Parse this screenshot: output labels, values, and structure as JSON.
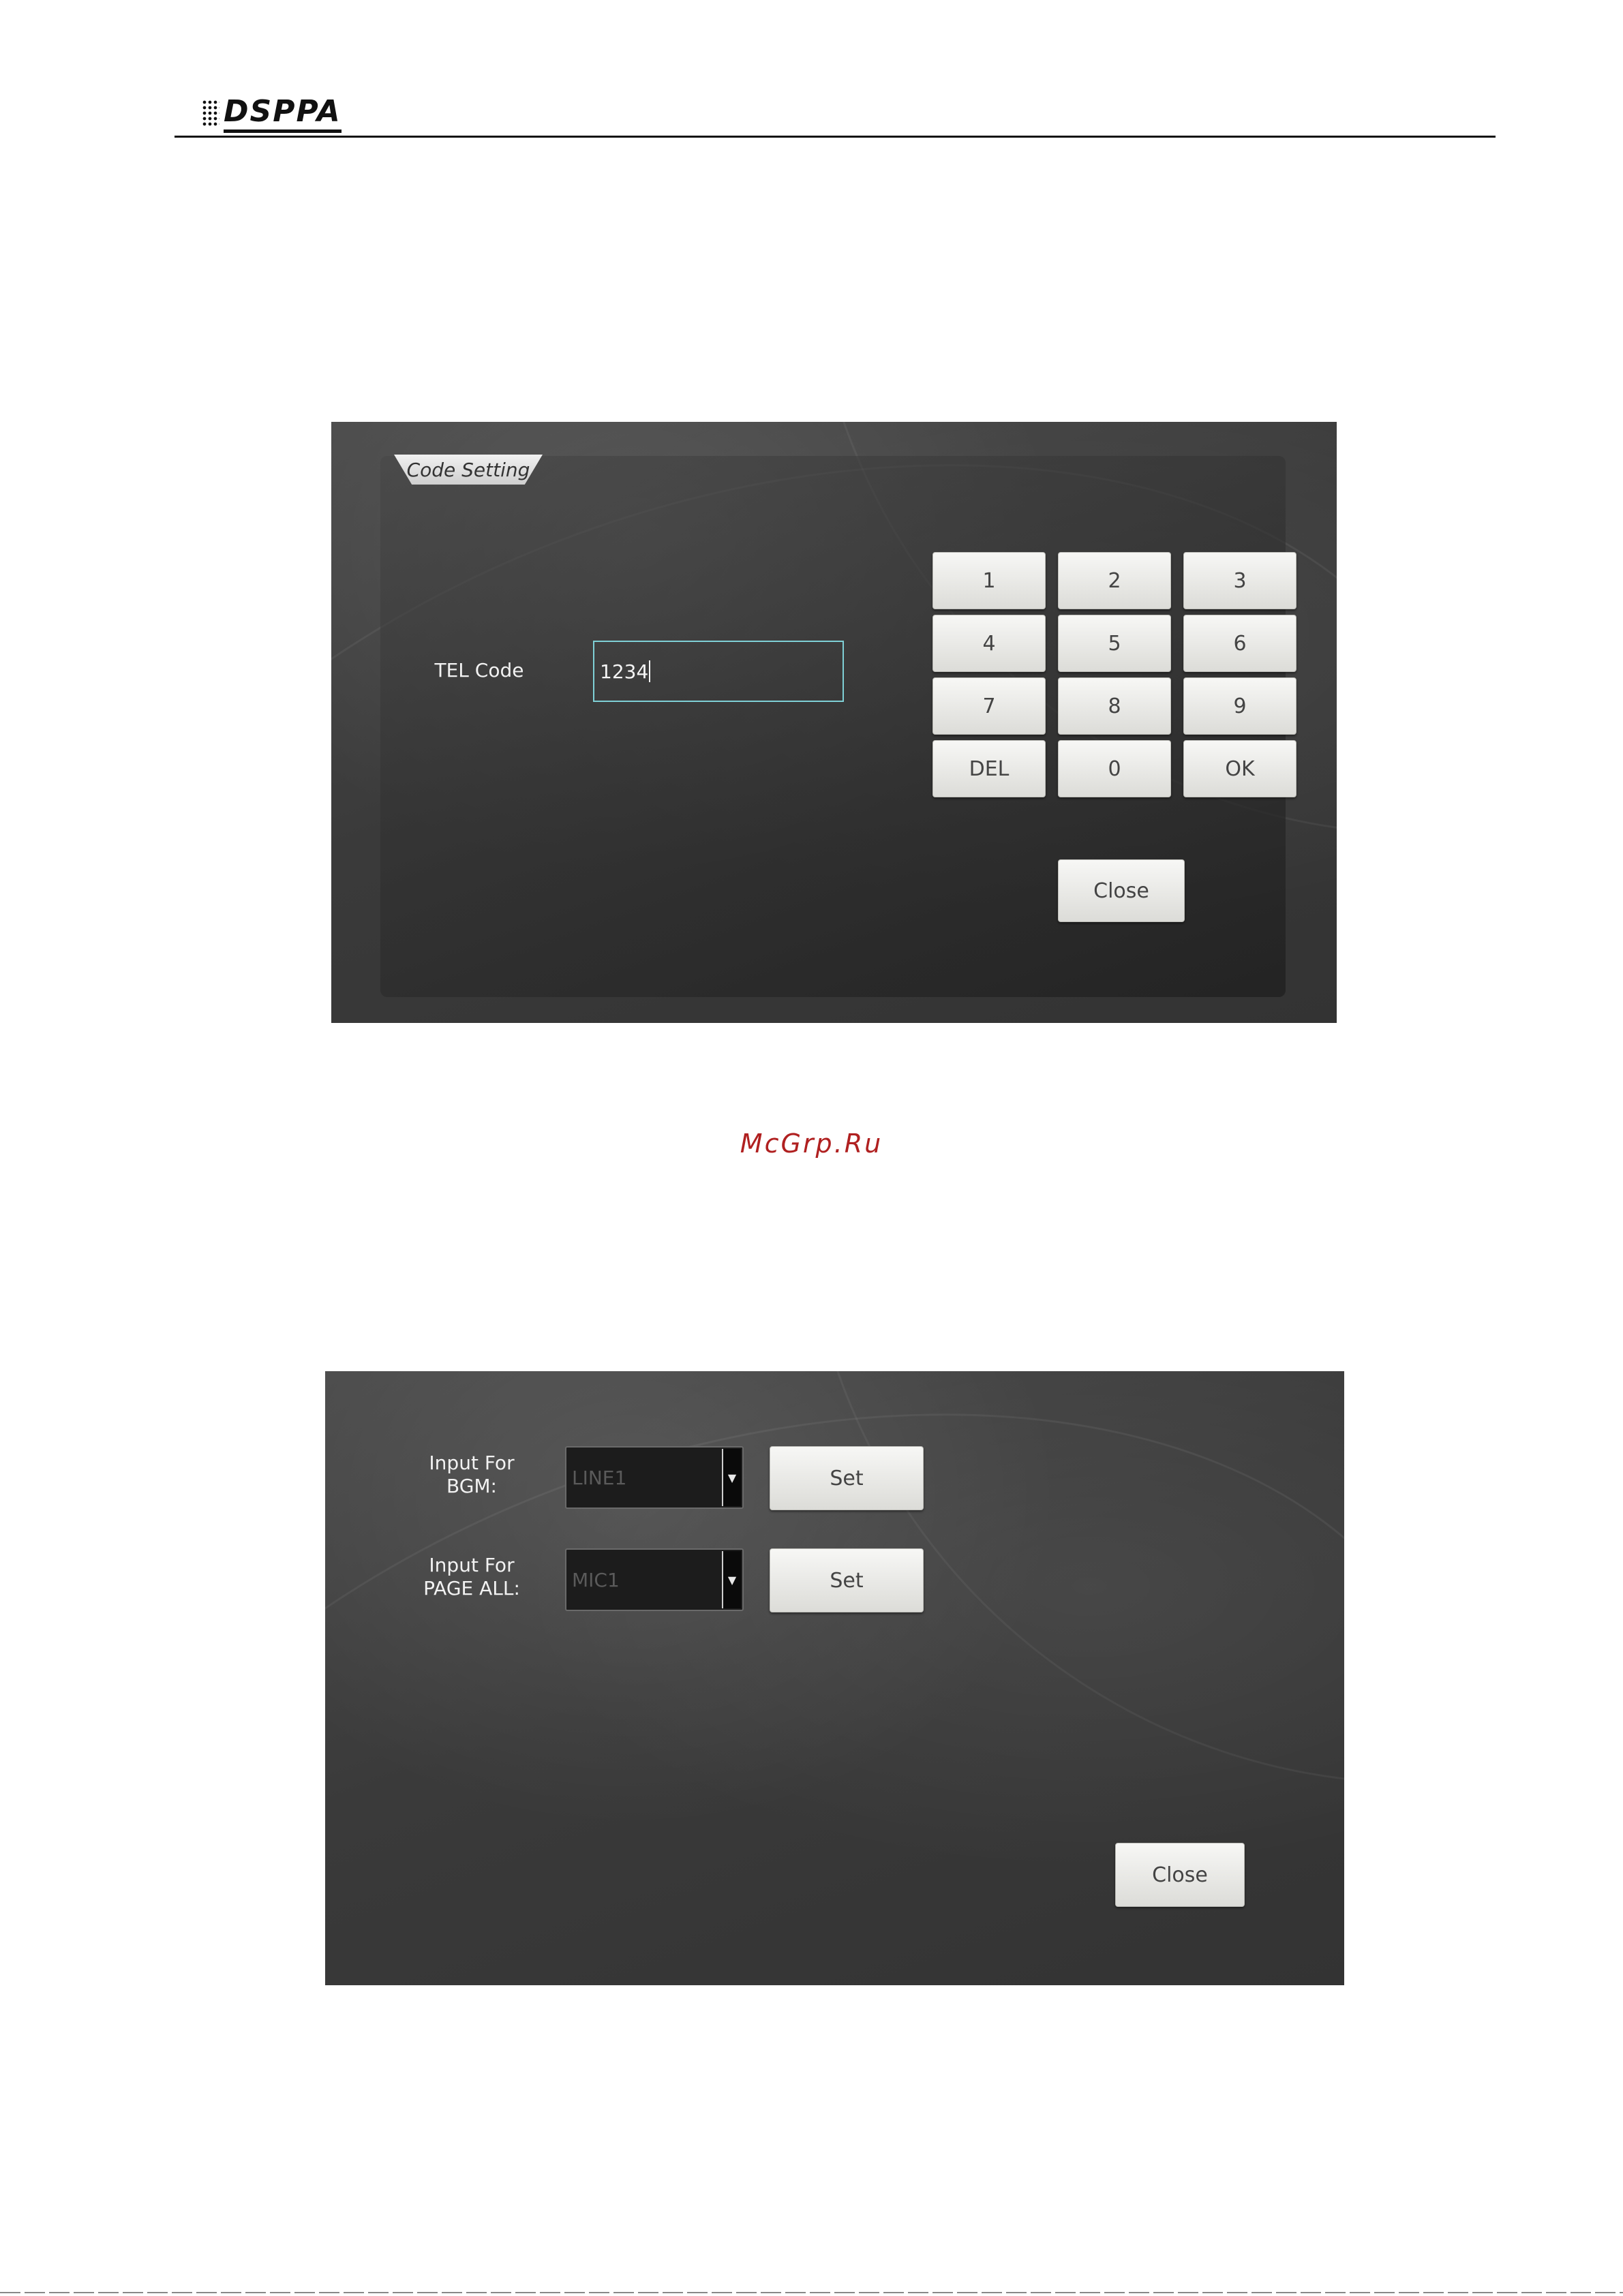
{
  "header": {
    "logo_text": "DSPPA"
  },
  "code_setting": {
    "panel_title": "Code Setting",
    "tel_code_label": "TEL Code",
    "tel_code_value": "1234",
    "keypad": [
      "1",
      "2",
      "3",
      "4",
      "5",
      "6",
      "7",
      "8",
      "9",
      "DEL",
      "0",
      "OK"
    ],
    "close_label": "Close"
  },
  "watermark": "McGrp.Ru",
  "input_settings": {
    "bgm_label_line1": "Input For",
    "bgm_label_line2": "BGM:",
    "bgm_value": "LINE1",
    "page_all_label_line1": "Input For",
    "page_all_label_line2": "PAGE ALL:",
    "page_all_value": "MIC1",
    "set_label": "Set",
    "close_label": "Close"
  }
}
